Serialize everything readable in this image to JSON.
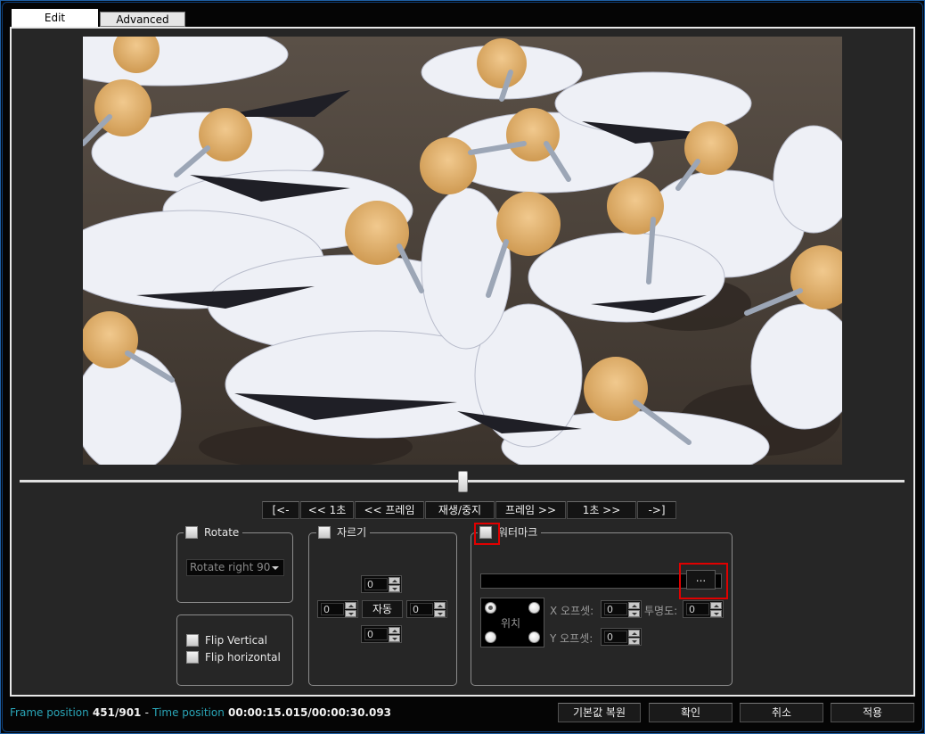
{
  "tabs": [
    {
      "label": "Edit",
      "active": true
    },
    {
      "label": "Advanced",
      "active": false
    }
  ],
  "player": {
    "seek_fraction": 0.5006
  },
  "nav_buttons": [
    "[<-",
    "<< 1초",
    "<< 프레임",
    "재생/중지",
    "프레임 >>",
    "1초 >>",
    "->]"
  ],
  "rotate": {
    "label": "Rotate",
    "checked": false,
    "selected_option": "Rotate right 90"
  },
  "flip": {
    "vertical_label": "Flip Vertical",
    "horizontal_label": "Flip horizontal"
  },
  "crop": {
    "label": "자르기",
    "top": "0",
    "left": "0",
    "right": "0",
    "bottom": "0",
    "auto_label": "자동"
  },
  "watermark": {
    "label": "워터마크",
    "path": "",
    "browse_label": "...",
    "position_label": "위치",
    "x_offset_label": "X 오프셋:",
    "x_offset": "0",
    "y_offset_label": "Y 오프셋:",
    "y_offset": "0",
    "opacity_label": "투명도:",
    "opacity": "0"
  },
  "status": {
    "frame_label": "Frame position",
    "frame_value": "451/901",
    "dash": "-",
    "time_label": "Time position",
    "time_value": "00:00:15.015/00:00:30.093"
  },
  "buttons": {
    "reset": "기본값 복원",
    "ok": "확인",
    "cancel": "취소",
    "apply": "적용"
  },
  "colors": {
    "panel_bg": "#262626",
    "status_key": "#2aa6b8",
    "highlight": "#e00000"
  },
  "icons": [
    "dropdown-arrow-icon",
    "spin-up-icon",
    "spin-down-icon"
  ]
}
